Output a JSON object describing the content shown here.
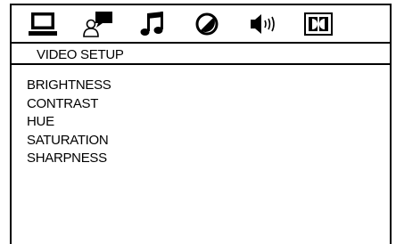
{
  "tabs": [
    {
      "icon": "monitor-icon"
    },
    {
      "icon": "user-settings-icon"
    },
    {
      "icon": "music-note-icon"
    },
    {
      "icon": "contrast-icon"
    },
    {
      "icon": "speaker-volume-icon"
    },
    {
      "icon": "dolby-icon"
    }
  ],
  "header": {
    "title": "VIDEO SETUP"
  },
  "menu": {
    "items": [
      {
        "label": "BRIGHTNESS"
      },
      {
        "label": "CONTRAST"
      },
      {
        "label": "HUE"
      },
      {
        "label": "SATURATION"
      },
      {
        "label": "SHARPNESS"
      }
    ]
  }
}
